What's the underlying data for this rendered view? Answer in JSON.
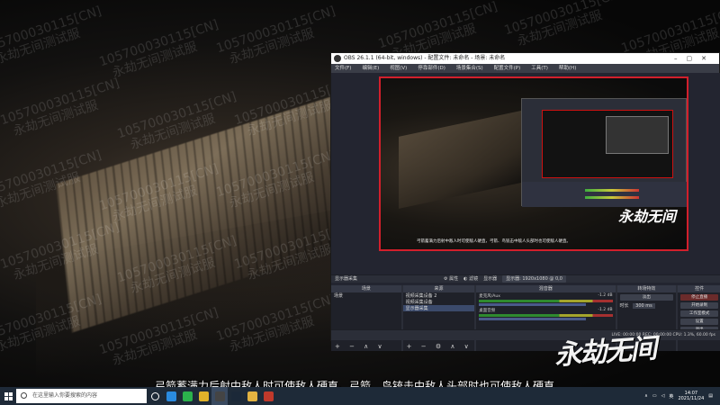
{
  "watermarks": [
    "105700030115[CN]",
    "永劫无间测试服"
  ],
  "obs": {
    "title": "OBS 26.1.1 (64-bit, windows) - 配置文件: 未命名 - 场景: 未命名",
    "menu": [
      "文件(F)",
      "编辑(E)",
      "视图(V)",
      "停靠部件(D)",
      "场景集合(S)",
      "配置文件(P)",
      "工具(T)",
      "帮助(H)"
    ],
    "source_toolbar": {
      "source_name": "显示器采集",
      "properties": "属性",
      "filters": "滤镜",
      "display_label": "显示器",
      "display_value": "显示器: 1920x1080 @ 0,0"
    },
    "docks": {
      "scenes": {
        "header": "场景",
        "items": [
          "场景"
        ]
      },
      "sources": {
        "header": "来源",
        "items": [
          "视频采集设备 2",
          "视频采集设备",
          "显示器采集"
        ]
      },
      "mixer": {
        "header": "混音器",
        "channels": [
          {
            "name": "麦克风/Aux",
            "db": "-1.2 dB"
          },
          {
            "name": "桌面音频",
            "db": "-1.2 dB"
          }
        ]
      },
      "transitions": {
        "header": "转场特效",
        "type": "淡出",
        "duration_label": "时长",
        "duration_value": "300 ms"
      },
      "controls": {
        "header": "控件",
        "buttons": [
          "停止直播",
          "开始录制",
          "工作室模式",
          "设置",
          "退出"
        ]
      }
    },
    "status_bar": "LIVE: 00:00:00   REC: 00:00:00   CPU: 1.3%, 60.00 fps"
  },
  "preview_subtitle": "弓箭蓄满力后射中敌人时可使敌人硬直，弓箭、鸟铳击中敌人头部时也可使敌人硬直。",
  "game_logo": "永劫无间",
  "subtitle": "弓箭蓄满力后射中敌人时可使敌人硬直，弓箭、鸟铳击中敌人头部时也可使敌人硬直。",
  "taskbar": {
    "search_placeholder": "在这里输入你要搜索的内容",
    "apps": [
      {
        "icon": "edge-icon",
        "color": "#2a8be0"
      },
      {
        "icon": "wechat-icon",
        "color": "#2bb24c"
      },
      {
        "icon": "app-yellow-icon",
        "color": "#e0b22a"
      },
      {
        "icon": "obs-icon",
        "color": "#444444"
      },
      {
        "icon": "steam-icon",
        "color": "#1b2838"
      },
      {
        "icon": "file-explorer-icon",
        "color": "#e3b341"
      },
      {
        "icon": "app-red-icon",
        "color": "#c0392b"
      }
    ],
    "time": "14:07",
    "date": "2021/11/24"
  },
  "colors": {
    "preview_border": "#d21f2b",
    "obs_bg": "#2b2e38",
    "taskbar_bg": "#1e2a38"
  }
}
